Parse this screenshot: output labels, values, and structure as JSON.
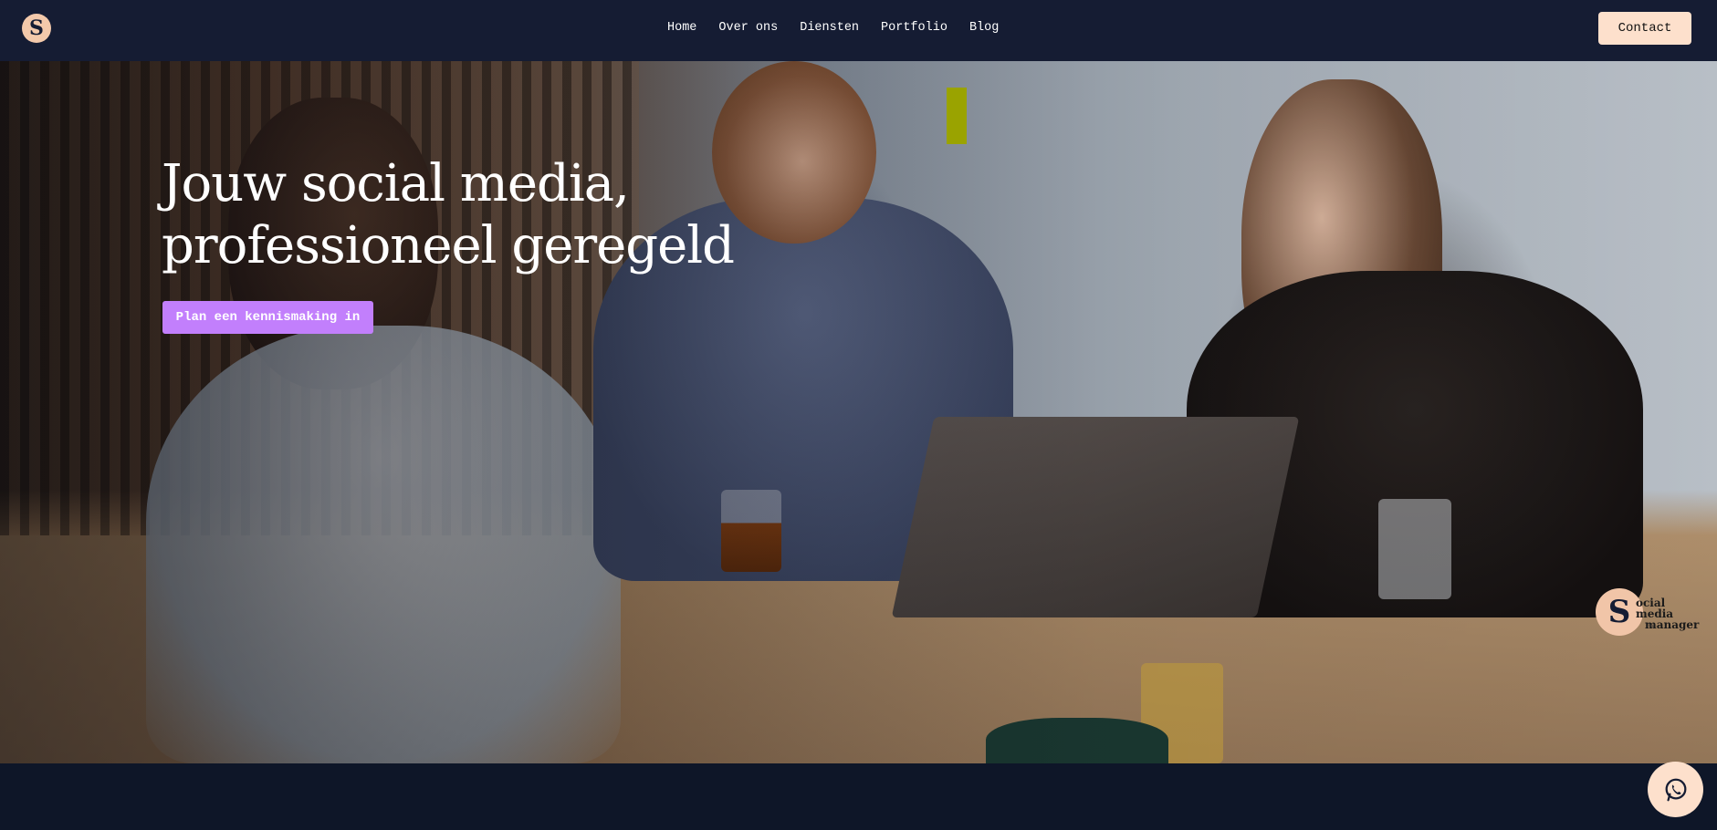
{
  "header": {
    "logo_letter": "S",
    "nav": [
      "Home",
      "Over ons",
      "Diensten",
      "Portfolio",
      "Blog"
    ],
    "contact_label": "Contact"
  },
  "hero": {
    "title_line1": "Jouw social media,",
    "title_line2": "professioneel geregeld",
    "cta_label": "Plan een kennismaking in",
    "badge": {
      "letter": "S",
      "name_line1": "ocial media",
      "name_line2": "manager",
      "tagline": "by ..."
    }
  },
  "icons": {
    "whatsapp": "whatsapp-icon",
    "logo": "logo-icon"
  },
  "colors": {
    "header_bg": "#151c33",
    "accent_purple": "#c27ffc",
    "peach": "#fde0cc",
    "logo_bg": "#f3c9ab",
    "page_bg": "#0e1628"
  }
}
